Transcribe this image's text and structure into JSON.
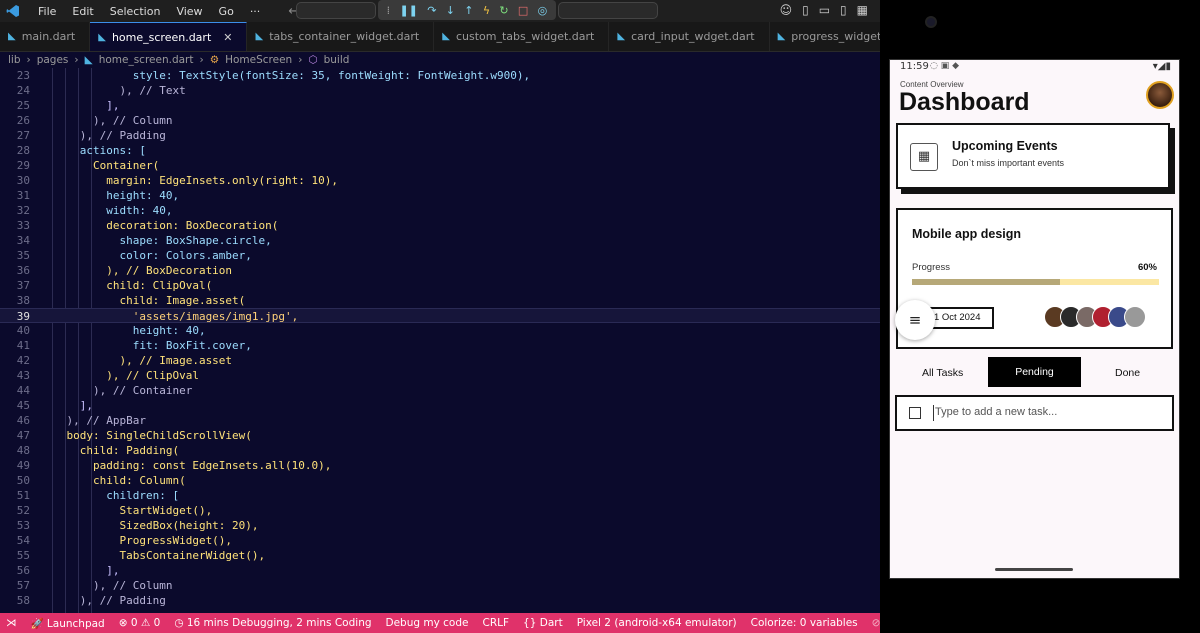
{
  "menu": [
    "File",
    "Edit",
    "Selection",
    "View",
    "Go",
    "···"
  ],
  "tabs": [
    {
      "label": "main.dart",
      "active": false
    },
    {
      "label": "home_screen.dart",
      "active": true
    },
    {
      "label": "tabs_container_widget.dart",
      "active": false
    },
    {
      "label": "custom_tabs_widget.dart",
      "active": false
    },
    {
      "label": "card_input_wdget.dart",
      "active": false
    },
    {
      "label": "progress_widget.dart",
      "active": false
    }
  ],
  "breadcrumb": [
    "lib",
    "pages",
    "home_screen.dart",
    "HomeScreen",
    "build"
  ],
  "code_lines": [
    {
      "n": "23",
      "t": "              style: TextStyle(fontSize: 35, fontWeight: FontWeight.w900),"
    },
    {
      "n": "24",
      "t": "            ), // Text"
    },
    {
      "n": "25",
      "t": "          ],"
    },
    {
      "n": "26",
      "t": "        ), // Column"
    },
    {
      "n": "27",
      "t": "      ), // Padding"
    },
    {
      "n": "28",
      "t": "      actions: ["
    },
    {
      "n": "29",
      "t": "        Container("
    },
    {
      "n": "30",
      "t": "          margin: EdgeInsets.only(right: 10),"
    },
    {
      "n": "31",
      "t": "          height: 40,"
    },
    {
      "n": "32",
      "t": "          width: 40,"
    },
    {
      "n": "33",
      "t": "          decoration: BoxDecoration("
    },
    {
      "n": "34",
      "t": "            shape: BoxShape.circle,"
    },
    {
      "n": "35",
      "t": "            color: Colors.amber,"
    },
    {
      "n": "36",
      "t": "          ), // BoxDecoration"
    },
    {
      "n": "37",
      "t": "          child: ClipOval("
    },
    {
      "n": "38",
      "t": "            child: Image.asset("
    },
    {
      "n": "39",
      "t": "              'assets/images/img1.jpg',"
    },
    {
      "n": "40",
      "t": "              height: 40,"
    },
    {
      "n": "41",
      "t": "              fit: BoxFit.cover,"
    },
    {
      "n": "42",
      "t": "            ), // Image.asset"
    },
    {
      "n": "43",
      "t": "          ), // ClipOval"
    },
    {
      "n": "44",
      "t": "        ), // Container"
    },
    {
      "n": "45",
      "t": "      ],"
    },
    {
      "n": "46",
      "t": "    ), // AppBar"
    },
    {
      "n": "47",
      "t": "    body: SingleChildScrollView("
    },
    {
      "n": "48",
      "t": "      child: Padding("
    },
    {
      "n": "49",
      "t": "        padding: const EdgeInsets.all(10.0),"
    },
    {
      "n": "50",
      "t": "        child: Column("
    },
    {
      "n": "51",
      "t": "          children: ["
    },
    {
      "n": "52",
      "t": "            StartWidget(),"
    },
    {
      "n": "53",
      "t": "            SizedBox(height: 20),"
    },
    {
      "n": "54",
      "t": "            ProgressWidget(),"
    },
    {
      "n": "55",
      "t": "            TabsContainerWidget(),"
    },
    {
      "n": "56",
      "t": "          ],"
    },
    {
      "n": "57",
      "t": "        ), // Column"
    },
    {
      "n": "58",
      "t": "      ), // Padding"
    }
  ],
  "current_line": "39",
  "statusbar": {
    "launchpad": "Launchpad",
    "problems": "⊗ 0 ⚠ 0",
    "debug_time": "16 mins Debugging, 2 mins Coding",
    "debug_mode": "Debug my code",
    "eol": "CRLF",
    "language": "{} Dart",
    "device": "Pixel 2 (android-x64 emulator)",
    "colorize": "Colorize: 0 variables",
    "colorize_toggle": "⊘ Colorize"
  },
  "phone": {
    "time": "11:59",
    "subtitle": "Content Overview",
    "title": "Dashboard",
    "events_title": "Upcoming Events",
    "events_sub": "Don`t miss important events",
    "project_title": "Mobile app design",
    "progress_label": "Progress",
    "progress_value": "60%",
    "progress_fraction": 0.6,
    "date": "1 Oct 2024",
    "tabs": [
      "All Tasks",
      "Pending",
      "Done"
    ],
    "task_placeholder": "Type to add a new task...",
    "accent": "#b6a878",
    "track": "#fbe7a3"
  }
}
